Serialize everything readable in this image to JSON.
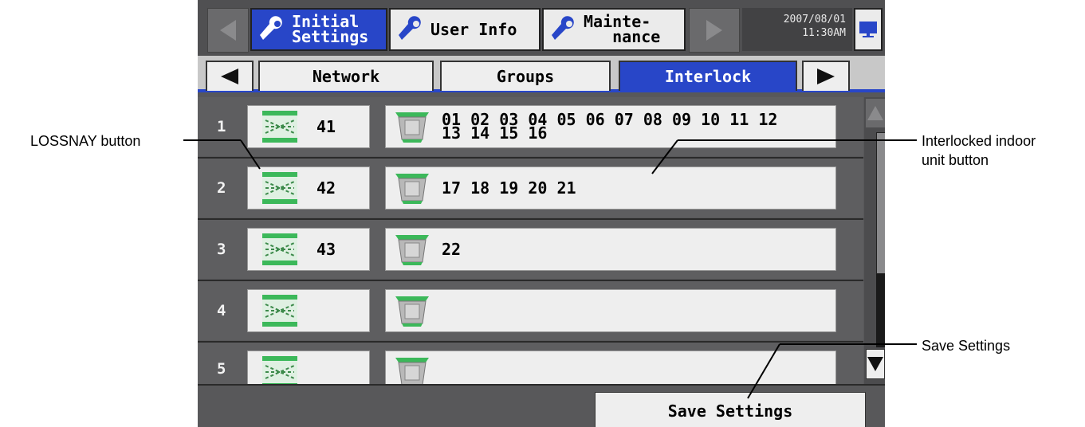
{
  "callouts": {
    "lossnay": "LOSSNAY button",
    "interlocked": [
      "Interlocked indoor",
      "unit button"
    ],
    "save": "Save Settings"
  },
  "topbar": {
    "tabs": [
      {
        "label": "Initial\nSettings",
        "active": true
      },
      {
        "label": "User Info",
        "active": false
      },
      {
        "label": "Mainte-\n   nance",
        "active": false
      }
    ],
    "date": "2007/08/01",
    "time": "11:30AM"
  },
  "subtabs": [
    {
      "label": "Network",
      "active": false
    },
    {
      "label": "Groups",
      "active": false
    },
    {
      "label": "Interlock",
      "active": true
    }
  ],
  "rows": [
    {
      "index": "1",
      "lossnay": "41",
      "units": "01 02 03 04 05 06 07 08 09 10 11 12\n13 14 15 16"
    },
    {
      "index": "2",
      "lossnay": "42",
      "units": "17 18 19 20 21"
    },
    {
      "index": "3",
      "lossnay": "43",
      "units": "22"
    },
    {
      "index": "4",
      "lossnay": "",
      "units": ""
    },
    {
      "index": "5",
      "lossnay": "",
      "units": ""
    }
  ],
  "save_button": "Save Settings",
  "icons": {
    "tool": "wrench-icon",
    "lossnay": "lossnay-icon",
    "indoor": "cassette-unit-icon",
    "monitor": "monitor-icon"
  },
  "colors": {
    "accent": "#2846c8",
    "icon_green": "#3cb85a"
  }
}
